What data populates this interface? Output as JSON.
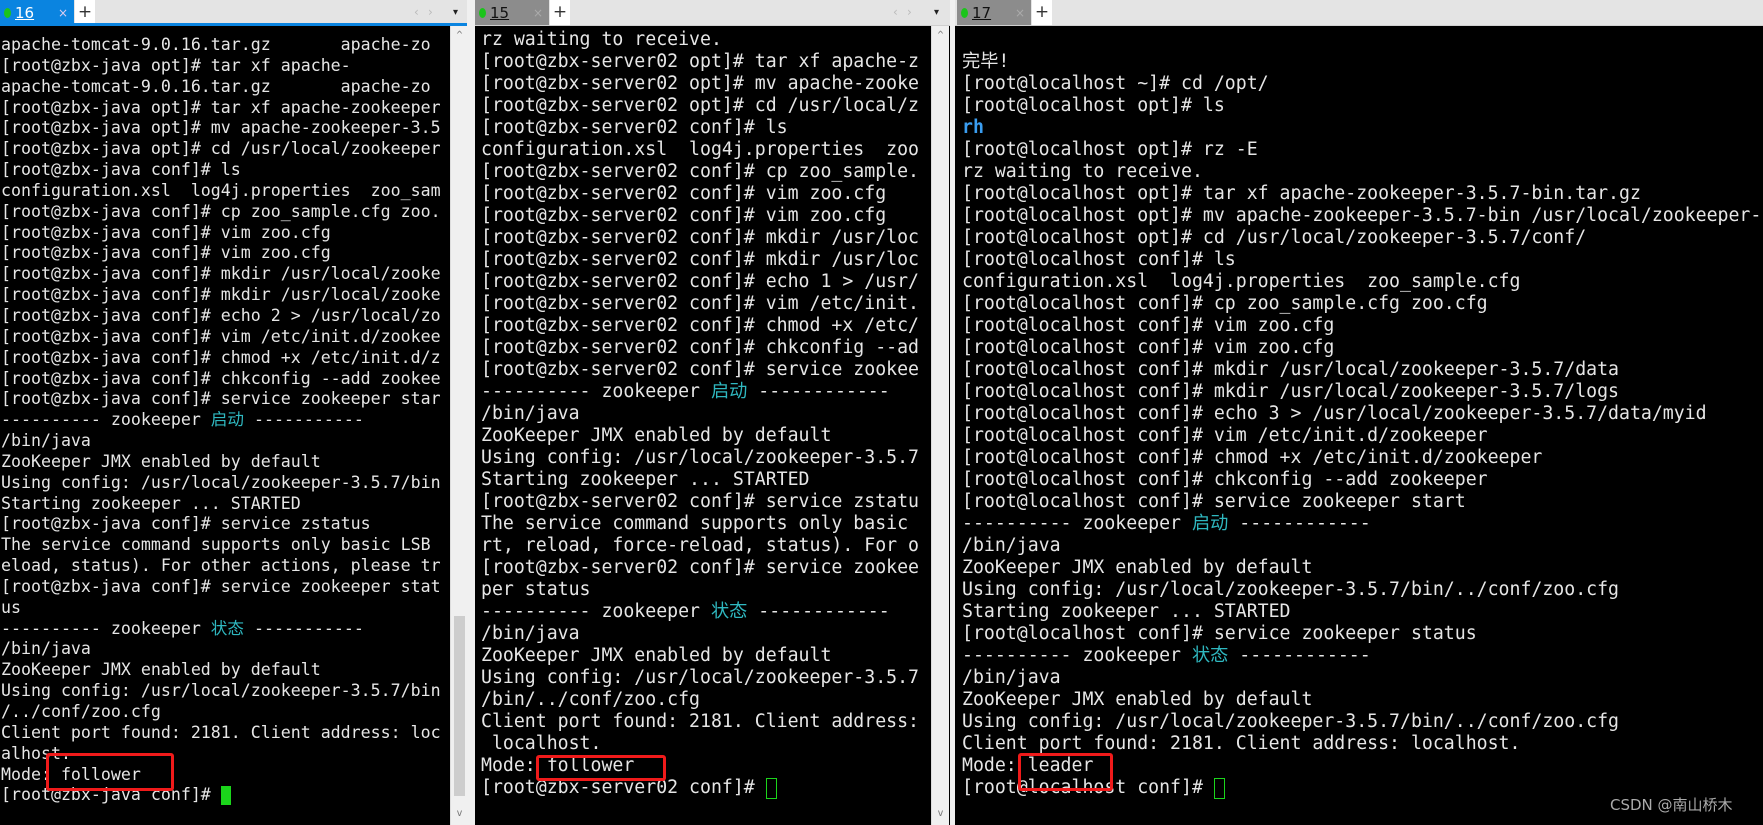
{
  "panes": [
    {
      "tab": {
        "label": "16",
        "state": "active"
      },
      "cursor": "solid",
      "lines": [
        "apache-tomcat-9.0.16.tar.gz       apache-zo",
        "[root@zbx-java opt]# tar xf apache-",
        "apache-tomcat-9.0.16.tar.gz       apache-zo",
        "[root@zbx-java opt]# tar xf apache-zookeeper",
        "[root@zbx-java opt]# mv apache-zookeeper-3.5",
        "[root@zbx-java opt]# cd /usr/local/zookeeper",
        "[root@zbx-java conf]# ls",
        "configuration.xsl  log4j.properties  zoo_sam",
        "[root@zbx-java conf]# cp zoo_sample.cfg zoo.",
        "[root@zbx-java conf]# vim zoo.cfg",
        "[root@zbx-java conf]# vim zoo.cfg",
        "[root@zbx-java conf]# mkdir /usr/local/zooke",
        "[root@zbx-java conf]# mkdir /usr/local/zooke",
        "[root@zbx-java conf]# echo 2 > /usr/local/zo",
        "[root@zbx-java conf]# vim /etc/init.d/zookee",
        "[root@zbx-java conf]# chmod +x /etc/init.d/z",
        "[root@zbx-java conf]# chkconfig --add zookee",
        "[root@zbx-java conf]# service zookeeper star",
        [
          "---------- zookeeper ",
          "启动",
          " -----------"
        ],
        "/bin/java",
        "ZooKeeper JMX enabled by default",
        "Using config: /usr/local/zookeeper-3.5.7/bin",
        "Starting zookeeper ... STARTED",
        "[root@zbx-java conf]# service zstatus",
        "The service command supports only basic LSB",
        "eload, status). For other actions, please tr",
        "[root@zbx-java conf]# service zookeeper stat",
        "us",
        [
          "---------- zookeeper ",
          "状态",
          " -----------"
        ],
        "/bin/java",
        "ZooKeeper JMX enabled by default",
        "Using config: /usr/local/zookeeper-3.5.7/bin",
        "/../conf/zoo.cfg",
        "Client port found: 2181. Client address: loc",
        "alhost.",
        "Mode: follower",
        "[root@zbx-java conf]# "
      ]
    },
    {
      "tab": {
        "label": "15",
        "state": "inactive"
      },
      "cursor": "hollow",
      "lines": [
        "rz waiting to receive.",
        "[root@zbx-server02 opt]# tar xf apache-z",
        "[root@zbx-server02 opt]# mv apache-zooke",
        "[root@zbx-server02 opt]# cd /usr/local/z",
        "[root@zbx-server02 conf]# ls",
        "configuration.xsl  log4j.properties  zoo",
        "[root@zbx-server02 conf]# cp zoo_sample.",
        "[root@zbx-server02 conf]# vim zoo.cfg",
        "[root@zbx-server02 conf]# vim zoo.cfg",
        "[root@zbx-server02 conf]# mkdir /usr/loc",
        "[root@zbx-server02 conf]# mkdir /usr/loc",
        "[root@zbx-server02 conf]# echo 1 > /usr/",
        "[root@zbx-server02 conf]# vim /etc/init.",
        "[root@zbx-server02 conf]# chmod +x /etc/",
        "[root@zbx-server02 conf]# chkconfig --ad",
        "[root@zbx-server02 conf]# service zookee",
        [
          "---------- zookeeper ",
          "启动",
          " ------------"
        ],
        "/bin/java",
        "ZooKeeper JMX enabled by default",
        "Using config: /usr/local/zookeeper-3.5.7",
        "Starting zookeeper ... STARTED",
        "[root@zbx-server02 conf]# service zstatu",
        "The service command supports only basic",
        "rt, reload, force-reload, status). For o",
        "[root@zbx-server02 conf]# service zookee",
        "per status",
        [
          "---------- zookeeper ",
          "状态",
          " ------------"
        ],
        "/bin/java",
        "ZooKeeper JMX enabled by default",
        "Using config: /usr/local/zookeeper-3.5.7",
        "/bin/../conf/zoo.cfg",
        "Client port found: 2181. Client address:",
        " localhost.",
        "Mode: follower",
        "[root@zbx-server02 conf]# "
      ]
    },
    {
      "tab": {
        "label": "17",
        "state": "inactive"
      },
      "cursor": "hollow",
      "lines": [
        "",
        "完毕!",
        "[root@localhost ~]# cd /opt/",
        "[root@localhost opt]# ls",
        {
          "dir": "rh"
        },
        "[root@localhost opt]# rz -E",
        "rz waiting to receive.",
        "[root@localhost opt]# tar xf apache-zookeeper-3.5.7-bin.tar.gz",
        "[root@localhost opt]# mv apache-zookeeper-3.5.7-bin /usr/local/zookeeper-",
        "[root@localhost opt]# cd /usr/local/zookeeper-3.5.7/conf/",
        "[root@localhost conf]# ls",
        "configuration.xsl  log4j.properties  zoo_sample.cfg",
        "[root@localhost conf]# cp zoo_sample.cfg zoo.cfg",
        "[root@localhost conf]# vim zoo.cfg",
        "[root@localhost conf]# vim zoo.cfg",
        "[root@localhost conf]# mkdir /usr/local/zookeeper-3.5.7/data",
        "[root@localhost conf]# mkdir /usr/local/zookeeper-3.5.7/logs",
        "[root@localhost conf]# echo 3 > /usr/local/zookeeper-3.5.7/data/myid",
        "[root@localhost conf]# vim /etc/init.d/zookeeper",
        "[root@localhost conf]# chmod +x /etc/init.d/zookeeper",
        "[root@localhost conf]# chkconfig --add zookeeper",
        "[root@localhost conf]# service zookeeper start",
        [
          "---------- zookeeper ",
          "启动",
          " ------------"
        ],
        "/bin/java",
        "ZooKeeper JMX enabled by default",
        "Using config: /usr/local/zookeeper-3.5.7/bin/../conf/zoo.cfg",
        "Starting zookeeper ... STARTED",
        "[root@localhost conf]# service zookeeper status",
        [
          "---------- zookeeper ",
          "状态",
          " ------------"
        ],
        "/bin/java",
        "ZooKeeper JMX enabled by default",
        "Using config: /usr/local/zookeeper-3.5.7/bin/../conf/zoo.cfg",
        "Client port found: 2181. Client address: localhost.",
        "Mode: leader",
        "[root@localhost conf]# "
      ]
    }
  ],
  "icons": {
    "close": "×",
    "add": "+",
    "prev": "‹",
    "next": "›",
    "dropdown": "▾",
    "scroll_up": "^",
    "scroll_down": "v"
  },
  "watermark": "CSDN @南山桥木",
  "colors": {
    "tab_active": "#0a84e0",
    "tab_inactive": "#8c8c8c",
    "status_dot": "#1bc41b",
    "cursor": "#1bd51b",
    "highlight_box": "#f01a1a",
    "chinese_status": "#2fb8c0",
    "dir": "#3a9df0"
  }
}
